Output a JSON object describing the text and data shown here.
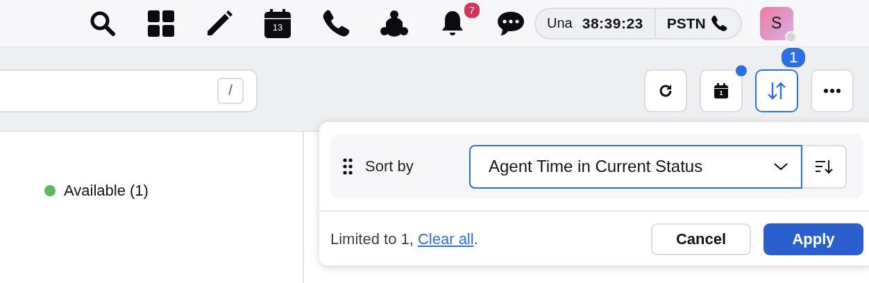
{
  "top_bar": {
    "calendar_day": "13",
    "notification_count": "7",
    "status": {
      "state": "Una",
      "timer": "38:39:23",
      "line": "PSTN"
    },
    "avatar": {
      "initial": "S",
      "online": false
    }
  },
  "search": {
    "shortcut": "/"
  },
  "actions": {
    "calendar_day": "1",
    "calendar_indicator": true,
    "sort_active": true,
    "sort_count": "1"
  },
  "legend": [
    {
      "label": "Available (1)",
      "color": "#5cb85c"
    }
  ],
  "sort_popover": {
    "rows": [
      {
        "label": "Sort by",
        "field": "Agent Time in Current Status"
      }
    ],
    "note_prefix": "Limited to 1, ",
    "link": "Clear all",
    "note_suffix": ".",
    "buttons": [
      {
        "label": "Cancel",
        "kind": "secondary"
      },
      {
        "label": "Apply",
        "kind": "primary"
      }
    ]
  }
}
